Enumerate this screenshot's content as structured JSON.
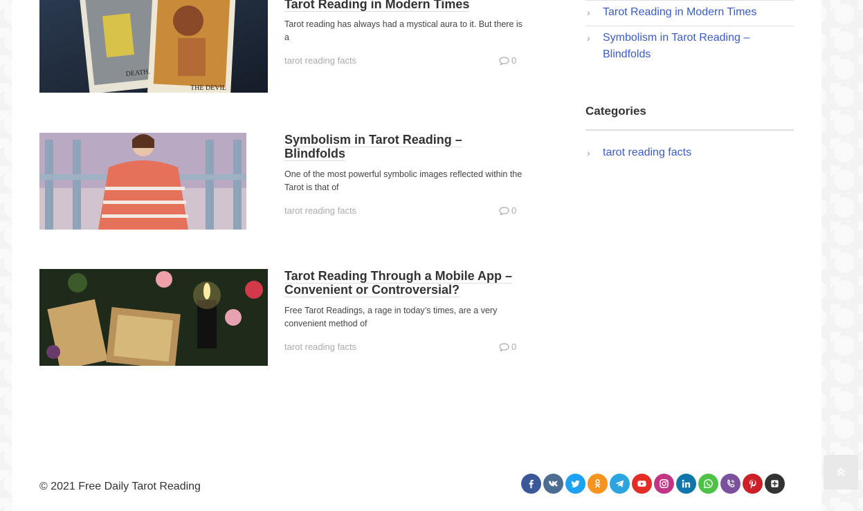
{
  "posts": [
    {
      "title": "Tarot Reading in Modern Times",
      "excerpt": "Tarot reading has always had a mystical aura to it. But there is a",
      "category": "tarot reading facts",
      "comments": "0"
    },
    {
      "title": "Symbolism in Tarot Reading – Blindfolds",
      "excerpt": "One of the most powerful symbolic images reflected within the Tarot is that of",
      "category": "tarot reading facts",
      "comments": "0"
    },
    {
      "title": "Tarot Reading Through a Mobile App – Convenient or Controversial?",
      "excerpt": "Free Tarot Readings, a rage in today’s times, are a very convenient method of",
      "category": "tarot reading facts",
      "comments": "0"
    }
  ],
  "sidebar": {
    "recent_posts": [
      "Tarot Reading in Modern Times",
      "Symbolism in Tarot Reading – Blindfolds"
    ],
    "categories_title": "Categories",
    "categories": [
      "tarot reading facts"
    ]
  },
  "footer": {
    "copyright": "© 2021 Free Daily Tarot Reading",
    "socials": [
      {
        "name": "facebook",
        "color": "#3b5998",
        "glyph": "f"
      },
      {
        "name": "vk",
        "color": "#4c6c91",
        "glyph": "vk"
      },
      {
        "name": "twitter",
        "color": "#1da1f2",
        "glyph": "t"
      },
      {
        "name": "odnoklassniki",
        "color": "#f7931e",
        "glyph": "ok"
      },
      {
        "name": "telegram",
        "color": "#2ca5e0",
        "glyph": "tg"
      },
      {
        "name": "youtube",
        "color": "#e52d27",
        "glyph": "yt"
      },
      {
        "name": "instagram",
        "color": "#c13584",
        "glyph": "ig"
      },
      {
        "name": "linkedin",
        "color": "#0e76a8",
        "glyph": "in"
      },
      {
        "name": "whatsapp",
        "color": "#4dc247",
        "glyph": "wa"
      },
      {
        "name": "viber",
        "color": "#7b519d",
        "glyph": "vb"
      },
      {
        "name": "pinterest",
        "color": "#cb2027",
        "glyph": "p"
      },
      {
        "name": "other",
        "color": "#333333",
        "glyph": "+"
      }
    ]
  },
  "colors": {
    "link": "#3b5bc5",
    "title": "#333333",
    "meta": "#aaaaaa"
  }
}
